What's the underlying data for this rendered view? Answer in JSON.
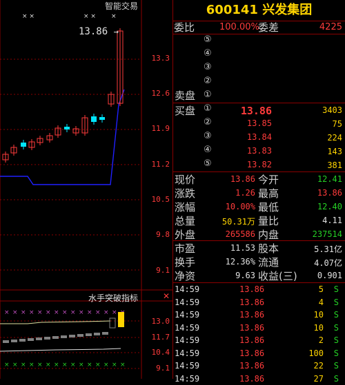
{
  "header": {
    "stock_code": "600141",
    "stock_name": "兴发集团",
    "strategy_label": "智能交易"
  },
  "colors": {
    "up": "#ff3b3b",
    "down": "#25d025",
    "accent": "#ffd400",
    "grid": "#8b0000",
    "line": "#2020ff",
    "cyan": "#00e5ff"
  },
  "price_chart": {
    "last_price_label": "13.86",
    "axis_labels": [
      "13.3",
      "12.6",
      "11.9",
      "11.2",
      "10.5",
      "9.8",
      "9.1"
    ]
  },
  "indicator": {
    "title": "水手突破指标",
    "axis_labels": [
      "13.0",
      "11.7",
      "10.4",
      "9.1"
    ]
  },
  "order_ratio": {
    "weibi_label": "委比",
    "weibi_value": "100.00%",
    "weicha_label": "委差",
    "weicha_value": "4225"
  },
  "sell": {
    "label": "卖盘",
    "levels": [
      "⑤",
      "④",
      "③",
      "②",
      "①"
    ]
  },
  "buy": {
    "label": "买盘",
    "levels": [
      {
        "idx": "①",
        "price": "13.86",
        "vol": "3403"
      },
      {
        "idx": "②",
        "price": "13.85",
        "vol": "75"
      },
      {
        "idx": "③",
        "price": "13.84",
        "vol": "224"
      },
      {
        "idx": "④",
        "price": "13.83",
        "vol": "143"
      },
      {
        "idx": "⑤",
        "price": "13.82",
        "vol": "381"
      }
    ]
  },
  "quote": [
    {
      "l1": "现价",
      "v1": "13.86",
      "l2": "今开",
      "v2": "12.41"
    },
    {
      "l1": "涨跌",
      "v1": "1.26",
      "l2": "最高",
      "v2": "13.86"
    },
    {
      "l1": "涨幅",
      "v1": "10.00%",
      "l2": "最低",
      "v2": "12.40"
    },
    {
      "l1": "总量",
      "v1": "50.31万",
      "l2": "量比",
      "v2": "4.11"
    },
    {
      "l1": "外盘",
      "v1": "265586",
      "l2": "内盘",
      "v2": "237514"
    }
  ],
  "fundamentals": [
    {
      "l1": "市盈",
      "v1": "11.53",
      "l2": "股本",
      "v2": "5.31亿"
    },
    {
      "l1": "换手",
      "v1": "12.36%",
      "l2": "流通",
      "v2": "4.07亿"
    },
    {
      "l1": "净资",
      "v1": "9.63",
      "l2": "收益(三)",
      "v2": "0.901"
    }
  ],
  "ticks": [
    {
      "time": "14:59",
      "price": "13.86",
      "vol": "5",
      "side": "S"
    },
    {
      "time": "14:59",
      "price": "13.86",
      "vol": "4",
      "side": "S"
    },
    {
      "time": "14:59",
      "price": "13.86",
      "vol": "10",
      "side": "S"
    },
    {
      "time": "14:59",
      "price": "13.86",
      "vol": "10",
      "side": "S"
    },
    {
      "time": "14:59",
      "price": "13.86",
      "vol": "2",
      "side": "S"
    },
    {
      "time": "14:59",
      "price": "13.86",
      "vol": "100",
      "side": "S"
    },
    {
      "time": "14:59",
      "price": "13.86",
      "vol": "22",
      "side": "S"
    },
    {
      "time": "14:59",
      "price": "13.86",
      "vol": "27",
      "side": "S"
    }
  ]
}
